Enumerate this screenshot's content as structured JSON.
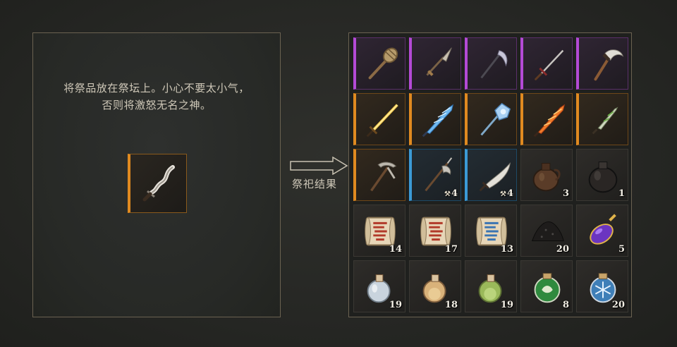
{
  "altar": {
    "instruction_line1": "将祭品放在祭坛上。小心不要太小气，",
    "instruction_line2": "否则将激怒无名之神。",
    "offering": {
      "icon": "curved-dagger-icon",
      "rarity": "legendary"
    }
  },
  "result_label": "祭祀结果",
  "rarity_colors": {
    "epic": "#b44ad6",
    "legendary": "#e08a20",
    "rare": "#3b9ad6",
    "common": "#3a3833"
  },
  "results": [
    {
      "icon": "mace-icon",
      "rarity": "epic",
      "qty": ""
    },
    {
      "icon": "spear-icon",
      "rarity": "epic",
      "qty": ""
    },
    {
      "icon": "scythe-icon",
      "rarity": "epic",
      "qty": ""
    },
    {
      "icon": "sword-icon",
      "rarity": "epic",
      "qty": ""
    },
    {
      "icon": "axe-icon",
      "rarity": "epic",
      "qty": ""
    },
    {
      "icon": "golden-sword-icon",
      "rarity": "legendary",
      "qty": ""
    },
    {
      "icon": "ice-sword-icon",
      "rarity": "legendary",
      "qty": ""
    },
    {
      "icon": "ice-mace-icon",
      "rarity": "legendary",
      "qty": ""
    },
    {
      "icon": "fire-sword-icon",
      "rarity": "legendary",
      "qty": ""
    },
    {
      "icon": "nature-dagger-icon",
      "rarity": "legendary",
      "qty": ""
    },
    {
      "icon": "pickaxe-icon",
      "rarity": "legendary",
      "qty": ""
    },
    {
      "icon": "halberd-icon",
      "rarity": "rare",
      "qty": "4",
      "mark": "⚒"
    },
    {
      "icon": "scimitar-icon",
      "rarity": "rare",
      "qty": "4",
      "mark": "⚒"
    },
    {
      "icon": "clay-jug-icon",
      "rarity": "common",
      "qty": "3"
    },
    {
      "icon": "black-jug-icon",
      "rarity": "common",
      "qty": "1"
    },
    {
      "icon": "red-scroll-icon",
      "rarity": "common",
      "qty": "14"
    },
    {
      "icon": "red-scroll-icon",
      "rarity": "common",
      "qty": "17"
    },
    {
      "icon": "blue-scroll-icon",
      "rarity": "common",
      "qty": "13"
    },
    {
      "icon": "ash-pile-icon",
      "rarity": "common",
      "qty": "20"
    },
    {
      "icon": "purple-elixir-icon",
      "rarity": "common",
      "qty": "5"
    },
    {
      "icon": "clear-potion-icon",
      "rarity": "common",
      "qty": "19"
    },
    {
      "icon": "amber-potion-icon",
      "rarity": "common",
      "qty": "18"
    },
    {
      "icon": "green-potion-icon",
      "rarity": "common",
      "qty": "19"
    },
    {
      "icon": "nature-orb-icon",
      "rarity": "common",
      "qty": "8"
    },
    {
      "icon": "frost-orb-icon",
      "rarity": "common",
      "qty": "20"
    }
  ]
}
